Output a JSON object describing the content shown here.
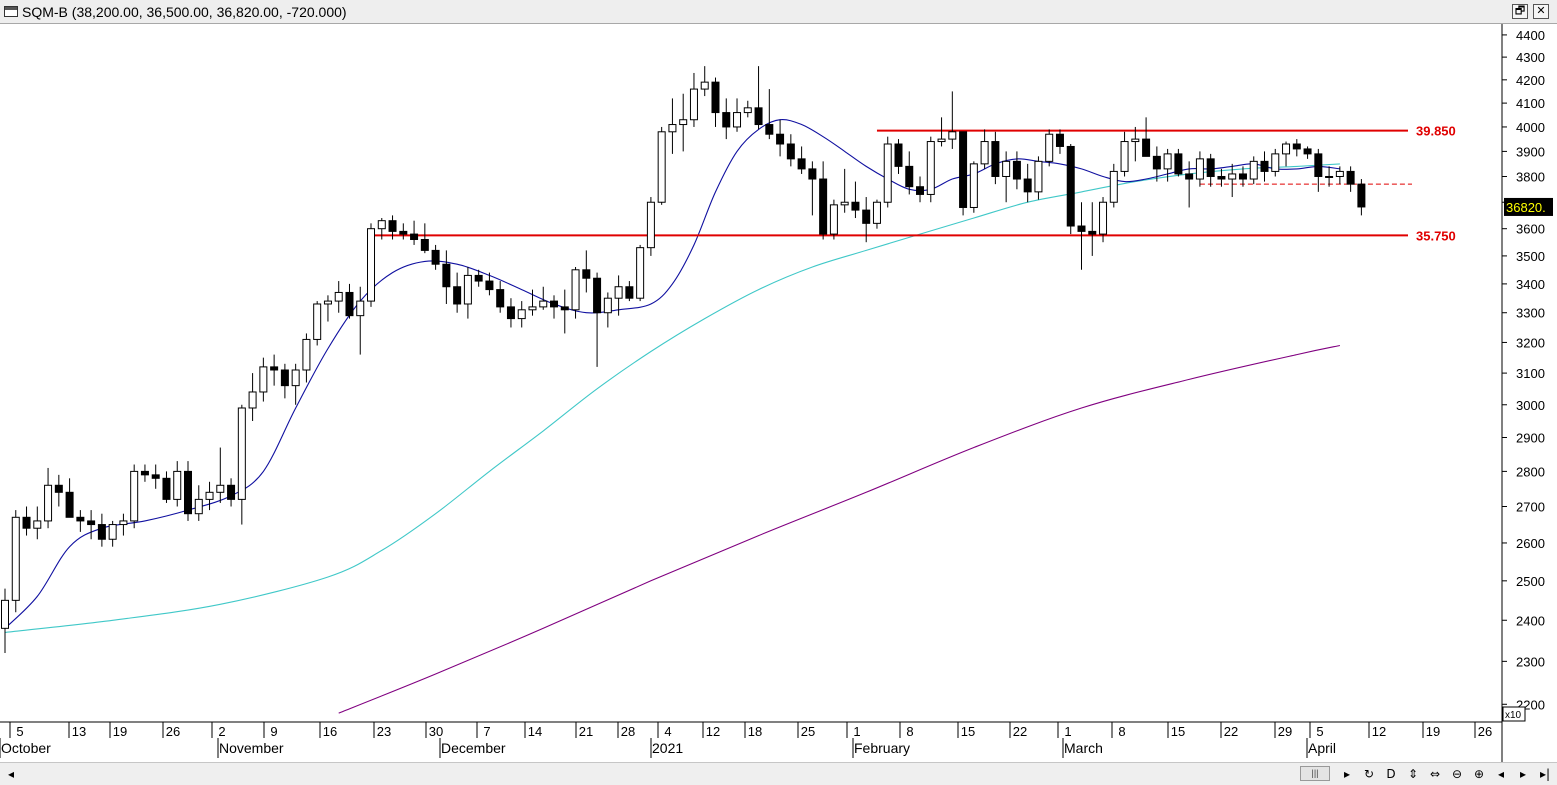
{
  "window": {
    "title": "SQM-B (38,200.00, 36,500.00, 36,820.00, -720.000)",
    "restore_label": "🗗",
    "close_label": "✕"
  },
  "colors": {
    "up_candle": "#ffffff",
    "down_candle": "#000000",
    "short_ma": "#1010a0",
    "mid_ma": "#40c8c8",
    "long_ma": "#800080",
    "support_resistance": "#e00000",
    "last_price_bg": "#000000",
    "last_price_text": "#ffff00"
  },
  "chart_data": {
    "type": "candlestick",
    "symbol": "SQM-B",
    "ohlc_summary": {
      "open": 38200.0,
      "high": 36500.0,
      "close": 36820.0,
      "change": -720.0
    },
    "y_ticks": [
      4400,
      4300,
      4200,
      4100,
      4000,
      3900,
      3800,
      3700,
      3600,
      3500,
      3400,
      3300,
      3200,
      3100,
      3000,
      2900,
      2800,
      2700,
      2600,
      2500,
      2400,
      2300,
      2200
    ],
    "y_scale_label": "x10",
    "ylim": [
      2160,
      4450
    ],
    "y_scale": "log",
    "last_price_label": "36820.",
    "x_day_ticks": [
      "5",
      "13",
      "19",
      "26",
      "2",
      "9",
      "16",
      "23",
      "30",
      "7",
      "14",
      "21",
      "28",
      "4",
      "12",
      "18",
      "25",
      "1",
      "8",
      "15",
      "22",
      "1",
      "8",
      "15",
      "22",
      "29",
      "5",
      "12",
      "19",
      "26"
    ],
    "x_month_labels": [
      "October",
      "November",
      "December",
      "2021",
      "February",
      "March",
      "April"
    ],
    "levels": [
      {
        "label": "39.850",
        "value": 3985
      },
      {
        "label": "35.750",
        "value": 3575
      }
    ],
    "dashed_level": 3770,
    "candles": [
      [
        2380,
        2480,
        2320,
        2450
      ],
      [
        2450,
        2690,
        2420,
        2670
      ],
      [
        2670,
        2700,
        2620,
        2640
      ],
      [
        2640,
        2700,
        2610,
        2660
      ],
      [
        2660,
        2810,
        2640,
        2760
      ],
      [
        2760,
        2790,
        2700,
        2740
      ],
      [
        2740,
        2780,
        2680,
        2670
      ],
      [
        2670,
        2690,
        2630,
        2660
      ],
      [
        2660,
        2690,
        2610,
        2650
      ],
      [
        2650,
        2680,
        2590,
        2610
      ],
      [
        2610,
        2660,
        2590,
        2650
      ],
      [
        2650,
        2680,
        2620,
        2660
      ],
      [
        2660,
        2820,
        2640,
        2800
      ],
      [
        2800,
        2820,
        2770,
        2790
      ],
      [
        2790,
        2820,
        2750,
        2780
      ],
      [
        2780,
        2800,
        2710,
        2720
      ],
      [
        2720,
        2830,
        2700,
        2800
      ],
      [
        2800,
        2830,
        2660,
        2680
      ],
      [
        2680,
        2760,
        2660,
        2720
      ],
      [
        2720,
        2770,
        2690,
        2740
      ],
      [
        2740,
        2870,
        2710,
        2760
      ],
      [
        2760,
        2780,
        2700,
        2720
      ],
      [
        2720,
        3000,
        2650,
        2990
      ],
      [
        2990,
        3100,
        2950,
        3040
      ],
      [
        3040,
        3150,
        3010,
        3120
      ],
      [
        3120,
        3160,
        3060,
        3110
      ],
      [
        3110,
        3130,
        3020,
        3060
      ],
      [
        3060,
        3130,
        3000,
        3110
      ],
      [
        3110,
        3230,
        3070,
        3210
      ],
      [
        3210,
        3340,
        3190,
        3330
      ],
      [
        3330,
        3360,
        3270,
        3340
      ],
      [
        3340,
        3410,
        3300,
        3370
      ],
      [
        3370,
        3400,
        3280,
        3290
      ],
      [
        3290,
        3390,
        3160,
        3340
      ],
      [
        3340,
        3620,
        3320,
        3600
      ],
      [
        3600,
        3640,
        3560,
        3630
      ],
      [
        3630,
        3650,
        3560,
        3590
      ],
      [
        3590,
        3620,
        3560,
        3580
      ],
      [
        3580,
        3630,
        3540,
        3560
      ],
      [
        3560,
        3620,
        3510,
        3520
      ],
      [
        3520,
        3540,
        3450,
        3470
      ],
      [
        3470,
        3520,
        3330,
        3390
      ],
      [
        3390,
        3440,
        3300,
        3330
      ],
      [
        3330,
        3460,
        3280,
        3430
      ],
      [
        3430,
        3450,
        3390,
        3410
      ],
      [
        3410,
        3440,
        3360,
        3380
      ],
      [
        3380,
        3410,
        3300,
        3320
      ],
      [
        3320,
        3350,
        3250,
        3280
      ],
      [
        3280,
        3340,
        3250,
        3310
      ],
      [
        3310,
        3380,
        3290,
        3320
      ],
      [
        3320,
        3390,
        3310,
        3340
      ],
      [
        3340,
        3360,
        3280,
        3320
      ],
      [
        3320,
        3380,
        3230,
        3310
      ],
      [
        3310,
        3460,
        3280,
        3450
      ],
      [
        3450,
        3520,
        3370,
        3420
      ],
      [
        3420,
        3440,
        3120,
        3300
      ],
      [
        3300,
        3370,
        3250,
        3350
      ],
      [
        3350,
        3430,
        3290,
        3390
      ],
      [
        3390,
        3410,
        3340,
        3350
      ],
      [
        3350,
        3540,
        3340,
        3530
      ],
      [
        3530,
        3720,
        3500,
        3700
      ],
      [
        3700,
        4000,
        3690,
        3980
      ],
      [
        3980,
        4120,
        3890,
        4010
      ],
      [
        4010,
        4140,
        3900,
        4030
      ],
      [
        4030,
        4230,
        4000,
        4160
      ],
      [
        4160,
        4260,
        4130,
        4190
      ],
      [
        4190,
        4210,
        4000,
        4060
      ],
      [
        4060,
        4120,
        3950,
        4000
      ],
      [
        4000,
        4120,
        3980,
        4060
      ],
      [
        4060,
        4110,
        4040,
        4080
      ],
      [
        4080,
        4260,
        3990,
        4010
      ],
      [
        4010,
        4160,
        3950,
        3970
      ],
      [
        3970,
        4030,
        3880,
        3930
      ],
      [
        3930,
        3970,
        3840,
        3870
      ],
      [
        3870,
        3920,
        3810,
        3830
      ],
      [
        3830,
        3860,
        3650,
        3790
      ],
      [
        3790,
        3860,
        3560,
        3580
      ],
      [
        3580,
        3710,
        3560,
        3690
      ],
      [
        3690,
        3830,
        3660,
        3700
      ],
      [
        3700,
        3780,
        3640,
        3670
      ],
      [
        3670,
        3720,
        3550,
        3620
      ],
      [
        3620,
        3710,
        3600,
        3700
      ],
      [
        3700,
        3960,
        3680,
        3930
      ],
      [
        3930,
        3950,
        3810,
        3840
      ],
      [
        3840,
        3900,
        3730,
        3760
      ],
      [
        3760,
        3800,
        3700,
        3730
      ],
      [
        3730,
        3960,
        3700,
        3940
      ],
      [
        3940,
        4040,
        3920,
        3950
      ],
      [
        3950,
        4150,
        3910,
        3980
      ],
      [
        3980,
        3980,
        3650,
        3680
      ],
      [
        3680,
        3860,
        3660,
        3850
      ],
      [
        3850,
        3990,
        3830,
        3940
      ],
      [
        3940,
        3980,
        3770,
        3800
      ],
      [
        3800,
        3900,
        3700,
        3860
      ],
      [
        3860,
        3900,
        3750,
        3790
      ],
      [
        3790,
        3850,
        3700,
        3740
      ],
      [
        3740,
        3880,
        3710,
        3860
      ],
      [
        3860,
        3990,
        3840,
        3970
      ],
      [
        3970,
        3990,
        3890,
        3920
      ],
      [
        3920,
        3930,
        3580,
        3610
      ],
      [
        3610,
        3700,
        3450,
        3590
      ],
      [
        3590,
        3700,
        3500,
        3580
      ],
      [
        3580,
        3720,
        3550,
        3700
      ],
      [
        3700,
        3850,
        3680,
        3820
      ],
      [
        3820,
        3980,
        3800,
        3940
      ],
      [
        3940,
        4000,
        3860,
        3950
      ],
      [
        3950,
        4040,
        3920,
        3880
      ],
      [
        3880,
        3920,
        3780,
        3830
      ],
      [
        3830,
        3910,
        3780,
        3890
      ],
      [
        3890,
        3910,
        3800,
        3810
      ],
      [
        3810,
        3860,
        3680,
        3790
      ],
      [
        3790,
        3900,
        3760,
        3870
      ],
      [
        3870,
        3890,
        3760,
        3800
      ],
      [
        3800,
        3830,
        3760,
        3790
      ],
      [
        3790,
        3850,
        3720,
        3810
      ],
      [
        3810,
        3840,
        3760,
        3790
      ],
      [
        3790,
        3880,
        3770,
        3860
      ],
      [
        3860,
        3900,
        3780,
        3820
      ],
      [
        3820,
        3910,
        3800,
        3890
      ],
      [
        3890,
        3940,
        3840,
        3930
      ],
      [
        3930,
        3950,
        3880,
        3910
      ],
      [
        3910,
        3920,
        3870,
        3890
      ],
      [
        3890,
        3910,
        3740,
        3800
      ],
      [
        3800,
        3840,
        3760,
        3800
      ],
      [
        3800,
        3840,
        3770,
        3820
      ],
      [
        3820,
        3840,
        3740,
        3770
      ],
      [
        3770,
        3790,
        3650,
        3682
      ]
    ],
    "ma_short_anchors": [
      [
        0,
        2380
      ],
      [
        3,
        2460
      ],
      [
        6,
        2590
      ],
      [
        9,
        2640
      ],
      [
        13,
        2660
      ],
      [
        17,
        2690
      ],
      [
        21,
        2730
      ],
      [
        24,
        2800
      ],
      [
        27,
        2990
      ],
      [
        30,
        3180
      ],
      [
        33,
        3340
      ],
      [
        36,
        3440
      ],
      [
        39,
        3480
      ],
      [
        42,
        3470
      ],
      [
        45,
        3430
      ],
      [
        48,
        3380
      ],
      [
        51,
        3330
      ],
      [
        54,
        3300
      ],
      [
        57,
        3310
      ],
      [
        60,
        3330
      ],
      [
        62,
        3400
      ],
      [
        64,
        3540
      ],
      [
        66,
        3740
      ],
      [
        68,
        3900
      ],
      [
        70,
        3990
      ],
      [
        72,
        4030
      ],
      [
        74,
        4010
      ],
      [
        76,
        3960
      ],
      [
        78,
        3900
      ],
      [
        80,
        3840
      ],
      [
        82,
        3790
      ],
      [
        84,
        3750
      ],
      [
        86,
        3750
      ],
      [
        88,
        3790
      ],
      [
        90,
        3810
      ],
      [
        92,
        3850
      ],
      [
        94,
        3870
      ],
      [
        96,
        3860
      ],
      [
        98,
        3850
      ],
      [
        100,
        3830
      ],
      [
        102,
        3800
      ],
      [
        104,
        3780
      ],
      [
        106,
        3790
      ],
      [
        108,
        3810
      ],
      [
        110,
        3830
      ],
      [
        112,
        3830
      ],
      [
        114,
        3840
      ],
      [
        116,
        3850
      ],
      [
        118,
        3830
      ],
      [
        120,
        3830
      ],
      [
        122,
        3840
      ],
      [
        124,
        3830
      ]
    ],
    "ma_mid_anchors": [
      [
        0,
        2370
      ],
      [
        10,
        2400
      ],
      [
        20,
        2440
      ],
      [
        30,
        2510
      ],
      [
        35,
        2580
      ],
      [
        40,
        2680
      ],
      [
        45,
        2800
      ],
      [
        50,
        2920
      ],
      [
        55,
        3050
      ],
      [
        60,
        3170
      ],
      [
        65,
        3280
      ],
      [
        70,
        3380
      ],
      [
        75,
        3460
      ],
      [
        80,
        3520
      ],
      [
        85,
        3580
      ],
      [
        90,
        3640
      ],
      [
        95,
        3700
      ],
      [
        100,
        3740
      ],
      [
        105,
        3780
      ],
      [
        110,
        3810
      ],
      [
        115,
        3830
      ],
      [
        120,
        3840
      ],
      [
        124,
        3850
      ]
    ],
    "ma_long_anchors": [
      [
        31,
        2180
      ],
      [
        40,
        2270
      ],
      [
        50,
        2380
      ],
      [
        60,
        2500
      ],
      [
        70,
        2620
      ],
      [
        80,
        2740
      ],
      [
        90,
        2870
      ],
      [
        100,
        2990
      ],
      [
        110,
        3080
      ],
      [
        120,
        3160
      ],
      [
        124,
        3190
      ]
    ]
  }
}
